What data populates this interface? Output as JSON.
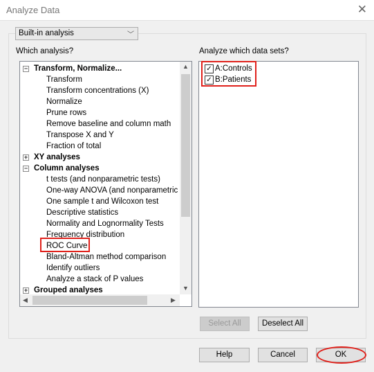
{
  "window": {
    "title": "Analyze Data"
  },
  "analysis_type": {
    "selected": "Built-in analysis"
  },
  "left": {
    "label": "Which analysis?",
    "items": [
      {
        "text": "Transform, Normalize...",
        "header": true,
        "expander": "⊟"
      },
      {
        "text": "Transform"
      },
      {
        "text": "Transform concentrations (X)"
      },
      {
        "text": "Normalize"
      },
      {
        "text": "Prune rows"
      },
      {
        "text": "Remove baseline and column math"
      },
      {
        "text": "Transpose X and Y"
      },
      {
        "text": "Fraction of total"
      },
      {
        "text": "XY analyses",
        "header": true,
        "expander": "⊞"
      },
      {
        "text": "Column analyses",
        "header": true,
        "expander": "⊟"
      },
      {
        "text": "t tests (and nonparametric tests)"
      },
      {
        "text": "One-way ANOVA (and nonparametric or"
      },
      {
        "text": "One sample t and Wilcoxon test"
      },
      {
        "text": "Descriptive statistics"
      },
      {
        "text": "Normality and Lognormality Tests"
      },
      {
        "text": "Frequency distribution"
      },
      {
        "text": "ROC Curve",
        "highlighted": true
      },
      {
        "text": "Bland-Altman method comparison"
      },
      {
        "text": "Identify outliers"
      },
      {
        "text": "Analyze a stack of P values"
      },
      {
        "text": "Grouped analyses",
        "header": true,
        "expander": "⊞"
      }
    ]
  },
  "right": {
    "label": "Analyze which data sets?",
    "datasets": [
      {
        "text": "A:Controls",
        "checked": true
      },
      {
        "text": "B:Patients",
        "checked": true
      }
    ],
    "select_all": "Select All",
    "deselect_all": "Deselect All"
  },
  "buttons": {
    "help": "Help",
    "cancel": "Cancel",
    "ok": "OK"
  },
  "colors": {
    "highlight": "#e0201a"
  }
}
